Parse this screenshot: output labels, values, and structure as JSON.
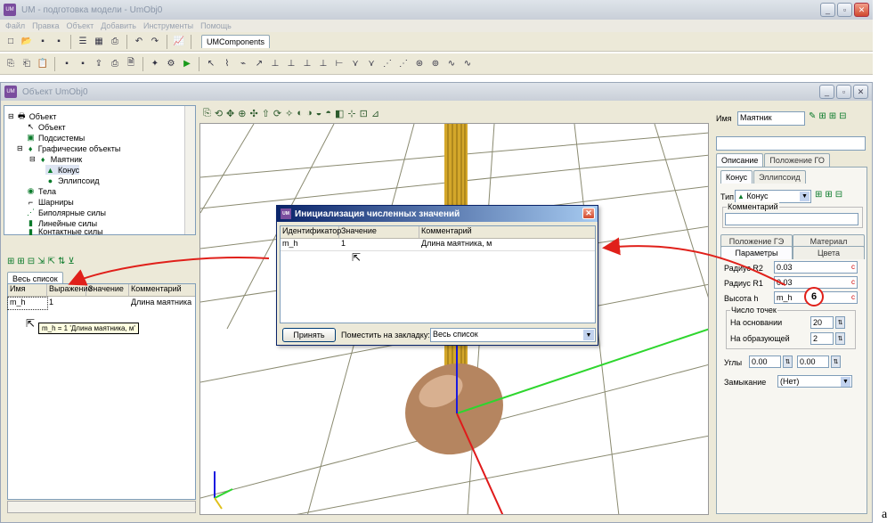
{
  "app": {
    "title": "UM - подготовка модели - UmObj0",
    "menu": [
      "Файл",
      "Правка",
      "Объект",
      "Добавить",
      "Инструменты",
      "Помощь"
    ],
    "components_tab": "UMComponents"
  },
  "object_window": {
    "title": "Объект UmObj0"
  },
  "tree": {
    "items": [
      "Объект",
      "Объект",
      "Подсистемы",
      "Графические объекты",
      "Маятник",
      "Конус",
      "Эллипсоид",
      "Тела",
      "Шарниры",
      "Биполярные силы",
      "Линейные силы",
      "Контактные силы"
    ]
  },
  "variables": {
    "tab": "Весь список",
    "columns": [
      "Имя",
      "Выражение",
      "Значение",
      "Комментарий"
    ],
    "rows": [
      {
        "name": "m_h",
        "expr": "1",
        "value": "",
        "comment": "Длина маятника"
      }
    ],
    "tooltip": "m_h = 1 'Длина маятника, м'"
  },
  "dialog": {
    "title": "Инициализация численных значений",
    "columns": [
      "Идентификатор",
      "Значение",
      "Комментарий"
    ],
    "rows": [
      {
        "id": "m_h",
        "value": "1",
        "comment": "Длина маятника, м"
      }
    ],
    "accept_label": "Принять",
    "place_label": "Поместить на закладку:",
    "place_value": "Весь список"
  },
  "props": {
    "name_label": "Имя",
    "name_value": "Маятник",
    "tabs_top": [
      "Описание",
      "Положение ГО"
    ],
    "tabs_sub": [
      "Конус",
      "Эллипсоид"
    ],
    "type_label": "Тип",
    "type_value": "Конус",
    "comment_label": "Комментарий",
    "tabs_bottom_row1": [
      "Положение ГЭ",
      "Материал"
    ],
    "tabs_bottom_row2": [
      "Параметры",
      "Цвета"
    ],
    "radius_r2_label": "Радиус R2",
    "radius_r2_value": "0.03",
    "radius_r1_label": "Радиус R1",
    "radius_r1_value": "0.03",
    "height_label": "Высота h",
    "height_value": "m_h",
    "callout": "6",
    "points_group": "Число точек",
    "base_label": "На основании",
    "base_value": "20",
    "gen_label": "На образующей",
    "gen_value": "2",
    "angles_label": "Углы",
    "angle1": "0.00",
    "angle2": "0.00",
    "closure_label": "Замыкание",
    "closure_value": "(Нет)",
    "c_mark": "c"
  },
  "corner_label": "a",
  "colors": {
    "arrow": "#e0201a",
    "axis_green": "#2ed62e",
    "axis_blue": "#1a1ae0",
    "axis_red": "#e01a1a",
    "body": "#b58560",
    "dialog_title_from": "#0a246a",
    "dialog_title_to": "#a6caf0"
  }
}
